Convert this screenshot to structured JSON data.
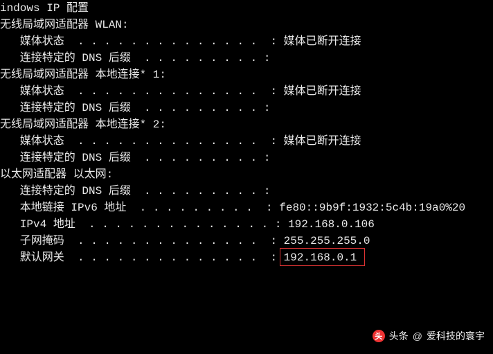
{
  "header": "Windows IP 配置",
  "adapters": [
    {
      "title": "无线局域网适配器 WLAN:",
      "rows": [
        {
          "label": "媒体状态",
          "value": "媒体已断开连接"
        },
        {
          "label": "连接特定的 DNS 后缀",
          "value": ""
        }
      ]
    },
    {
      "title": "无线局域网适配器 本地连接* 1:",
      "rows": [
        {
          "label": "媒体状态",
          "value": "媒体已断开连接"
        },
        {
          "label": "连接特定的 DNS 后缀",
          "value": ""
        }
      ]
    },
    {
      "title": "无线局域网适配器 本地连接* 2:",
      "rows": [
        {
          "label": "媒体状态",
          "value": "媒体已断开连接"
        },
        {
          "label": "连接特定的 DNS 后缀",
          "value": ""
        }
      ]
    },
    {
      "title": "以太网适配器 以太网:",
      "rows": [
        {
          "label": "连接特定的 DNS 后缀",
          "value": ""
        },
        {
          "label": "本地链接 IPv6 地址",
          "value": "fe80::9b9f:1932:5c4b:19a0%20"
        },
        {
          "label": "IPv4 地址",
          "value": "192.168.0.106"
        },
        {
          "label": "子网掩码",
          "value": "255.255.255.0"
        },
        {
          "label": "默认网关",
          "value": "192.168.0.1",
          "highlight": true
        }
      ]
    }
  ],
  "watermark": {
    "badge": "头",
    "prefix": "头条",
    "at": "@",
    "name": "爱科技的寰宇"
  }
}
